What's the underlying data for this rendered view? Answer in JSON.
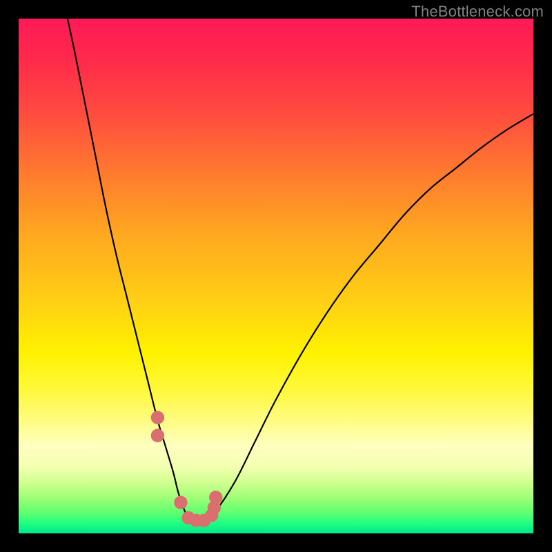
{
  "watermark": "TheBottleneck.com",
  "chart_data": {
    "type": "line",
    "title": "",
    "xlabel": "",
    "ylabel": "",
    "xlim": [
      0,
      100
    ],
    "ylim": [
      0,
      100
    ],
    "series": [
      {
        "name": "bottleneck-curve",
        "x": [
          9.5,
          11,
          13,
          15,
          17,
          19,
          21,
          23,
          25,
          27,
          28.5,
          30,
          31,
          32,
          33,
          34,
          36,
          38,
          42,
          46,
          50,
          55,
          60,
          65,
          70,
          75,
          80,
          85,
          90,
          95,
          100
        ],
        "values": [
          100,
          93,
          83,
          73,
          63,
          54,
          46,
          38,
          30,
          22,
          17,
          12,
          8,
          5,
          3,
          2.5,
          2.5,
          4,
          10,
          18,
          26,
          35,
          43,
          50,
          56,
          62,
          67,
          71,
          75,
          78.5,
          81.5
        ]
      }
    ],
    "markers": {
      "name": "highlighted-points",
      "x": [
        27.0,
        27.0,
        31.5,
        33.0,
        34.5,
        36.0,
        37.5,
        38.0,
        38.3
      ],
      "values": [
        22.5,
        19.0,
        6.0,
        3.0,
        2.5,
        2.5,
        3.5,
        5.0,
        7.0
      ],
      "color": "#db6f6f",
      "radius_pct": 1.3
    },
    "background_gradient": {
      "top": "#ff1a58",
      "bottom": "#00e890",
      "description": "vertical red-to-green rainbow gradient"
    }
  }
}
